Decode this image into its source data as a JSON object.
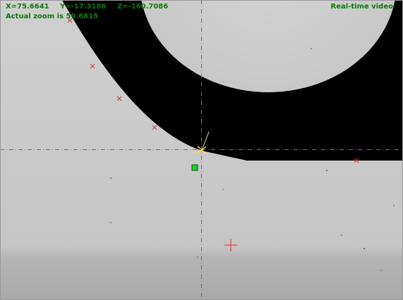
{
  "readout": {
    "x": "X=75.6641",
    "y": "Y=-17.3186",
    "z": "Z=-160.7086"
  },
  "zoom_text": "Actual zoom is 59.6815",
  "mode_label": "Real-time video",
  "colors": {
    "overlay_text": "#0a7a0a",
    "crosshair": "#cc33cc",
    "point_marker": "#e03030",
    "target_marker": "#22cc22",
    "part_fill": "#000000",
    "background": "#c9c9c9"
  },
  "icons": {
    "crosshair": "dash-dot-crosshair-icon",
    "point": "x-mark-icon",
    "target": "plus-target-icon",
    "anchor": "green-square-icon"
  }
}
